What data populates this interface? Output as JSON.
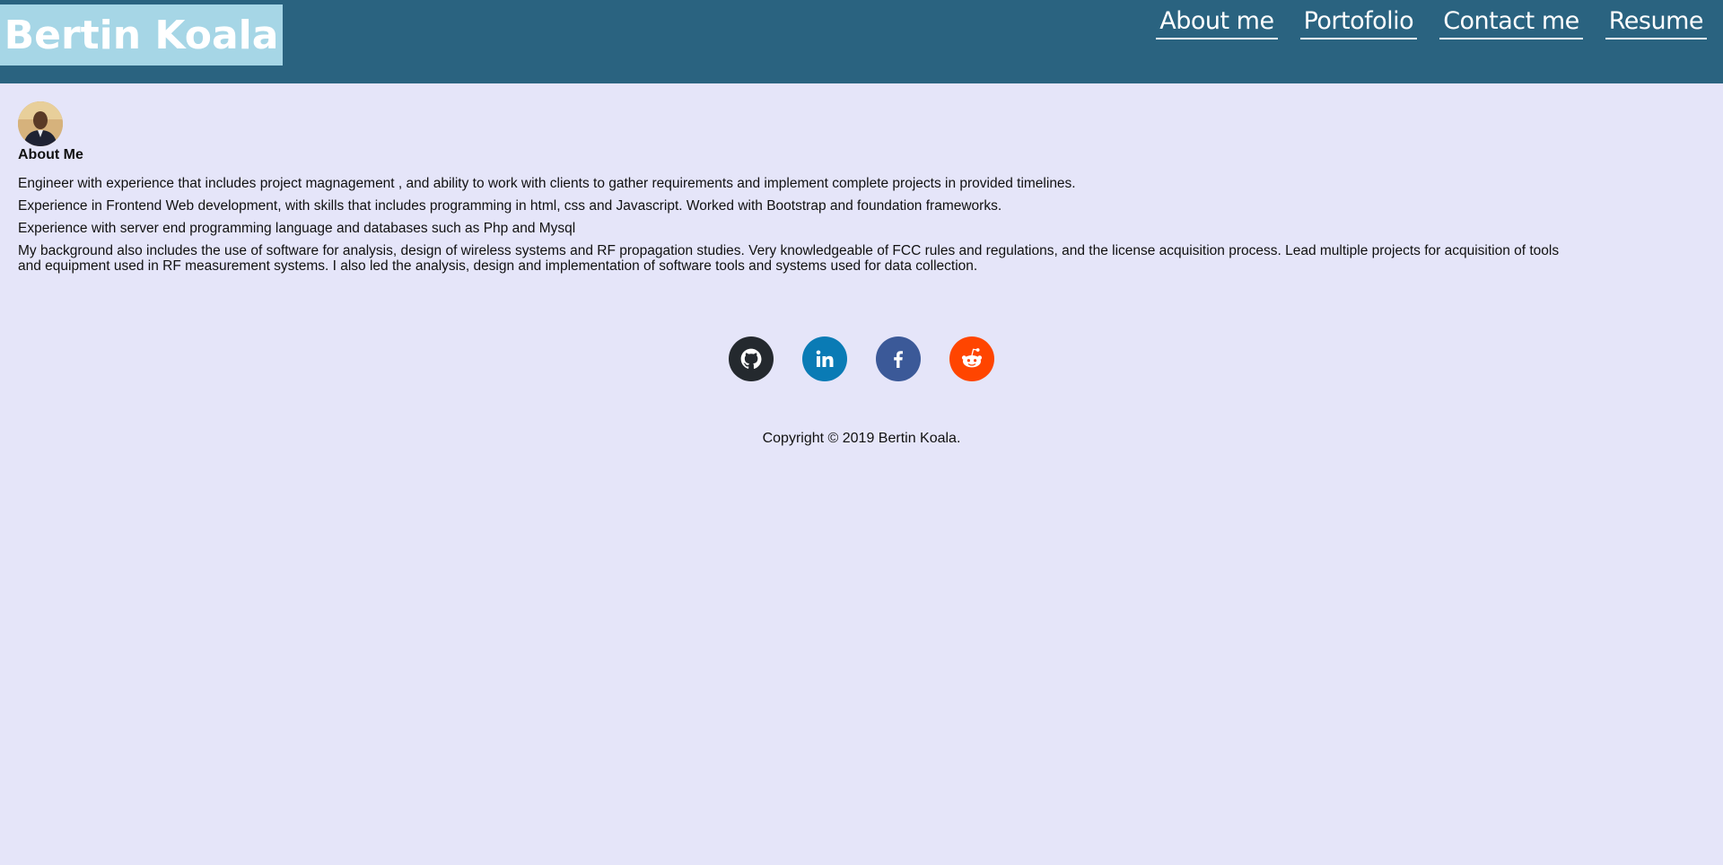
{
  "header": {
    "brand": "Bertin Koala",
    "nav": [
      {
        "label": "About me"
      },
      {
        "label": "Portofolio"
      },
      {
        "label": "Contact me"
      },
      {
        "label": "Resume"
      }
    ]
  },
  "about": {
    "title": "About Me",
    "paragraphs": [
      "Engineer with experience that includes project magnagement , and ability to work with clients to gather requirements and implement complete projects in provided timelines.",
      "Experience in Frontend Web development, with skills that includes programming in html, css and Javascript. Worked with Bootstrap and foundation frameworks.",
      "Experience with server end programming language and databases such as Php and Mysql",
      "My background also includes the use of software for analysis, design of wireless systems and RF propagation studies. Very knowledgeable of FCC rules and regulations, and the license acquisition process. Lead multiple projects for acquisition of tools and equipment used in RF measurement systems. I also led the analysis, design and implementation of software tools and systems used for data collection."
    ]
  },
  "social": [
    {
      "icon": "github-icon",
      "color": "#24292e"
    },
    {
      "icon": "linkedin-icon",
      "color": "#0a7bb5"
    },
    {
      "icon": "facebook-icon",
      "color": "#3b5998"
    },
    {
      "icon": "reddit-icon",
      "color": "#ff4500"
    }
  ],
  "footer": {
    "copyright": "Copyright © 2019 Bertin Koala."
  },
  "colors": {
    "header_bg": "#2a6380",
    "brand_bg": "#a6d6e6",
    "page_bg": "#e5e5f9"
  }
}
